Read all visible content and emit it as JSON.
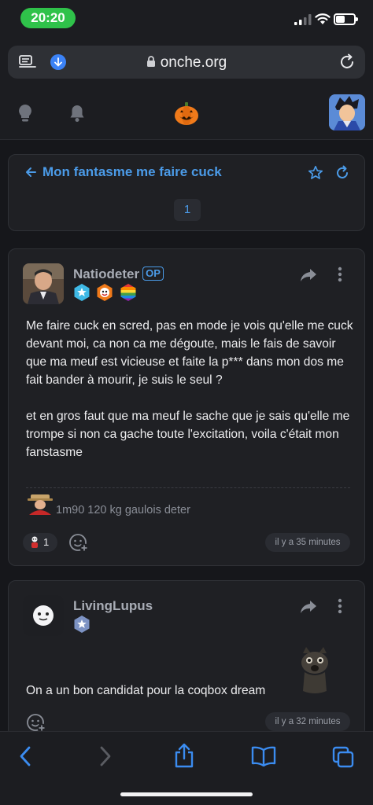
{
  "status_bar": {
    "time": "20:20"
  },
  "browser": {
    "domain": "onche.org"
  },
  "topic": {
    "title": "Mon fantasme me faire cuck",
    "current_page": "1"
  },
  "posts": [
    {
      "author": "Natiodeter",
      "op_label": "OP",
      "text": "Me faire cuck en scred, pas en mode je vois qu'elle me cuck devant moi, ca non ca me dégoute, mais le fais de savoir que ma meuf est vicieuse et faite la p*** dans mon dos me fait bander à mourir, je suis le seul ?\n\net en gros faut que ma meuf le sache que je sais qu'elle me trompe si non ca gache toute l'excitation, voila c'était mon fanstasme",
      "signature": "1m90 120 kg gaulois deter",
      "reaction_count": "1",
      "date": "il y a 35 minutes"
    },
    {
      "author": "LivingLupus",
      "text": "On a un bon candidat pour la coqbox dream",
      "date": "il y a 32 minutes"
    }
  ],
  "colors": {
    "accent": "#4b9be8",
    "status_green": "#2fc24a",
    "background": "#16171b",
    "card": "#1f2024"
  }
}
